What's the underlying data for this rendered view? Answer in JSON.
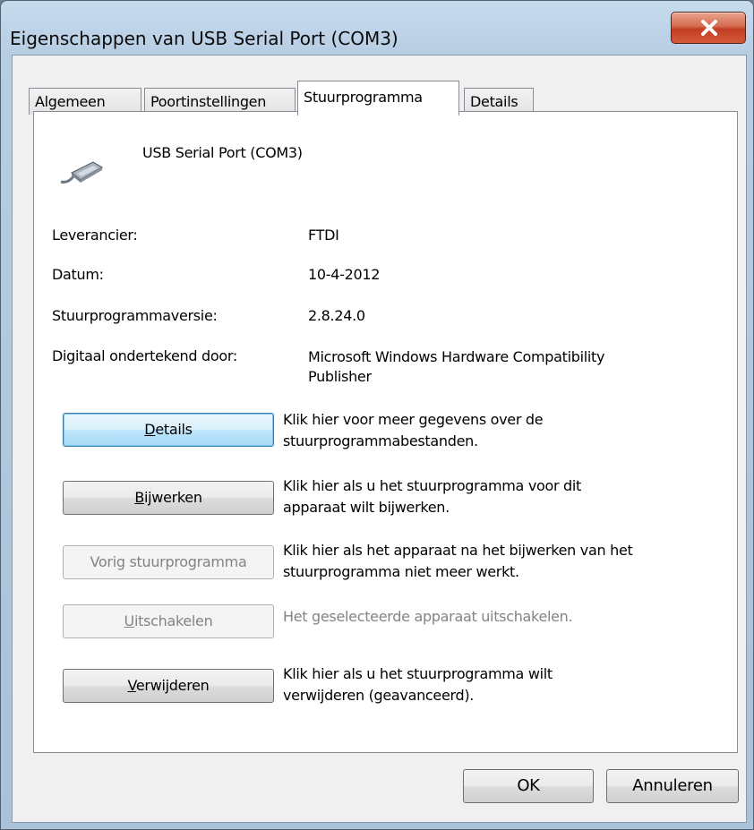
{
  "window": {
    "title": "Eigenschappen van USB Serial Port (COM3)",
    "close_glyph": "X"
  },
  "tabs": [
    {
      "label": "Algemeen"
    },
    {
      "label": "Poortinstellingen"
    },
    {
      "label": "Stuurprogramma",
      "active": true
    },
    {
      "label": "Details"
    }
  ],
  "device": {
    "name": "USB Serial Port (COM3)",
    "icon": "serial-cable-icon"
  },
  "info": {
    "provider_label": "Leverancier:",
    "provider_value": "FTDI",
    "date_label": "Datum:",
    "date_value": "10-4-2012",
    "version_label": "Stuurprogrammaversie:",
    "version_value": "2.8.24.0",
    "signer_label": "Digitaal ondertekend door:",
    "signer_value_line1": "Microsoft Windows Hardware Compatibility",
    "signer_value_line2": "Publisher"
  },
  "actions": {
    "details": {
      "label_pre": "",
      "label_key": "D",
      "label_post": "etails",
      "desc_line1": "Klik hier voor meer gegevens over de",
      "desc_line2": "stuurprogrammabestanden."
    },
    "update": {
      "label_pre": "",
      "label_key": "B",
      "label_post": "ijwerken",
      "desc_line1": "Klik hier als u het stuurprogramma voor dit",
      "desc_line2": "apparaat wilt bijwerken."
    },
    "rollback": {
      "label": "Vorig stuurprogramma",
      "desc_line1": "Klik hier als het apparaat na het bijwerken van het",
      "desc_line2": "stuurprogramma niet meer werkt."
    },
    "disable": {
      "label_pre": "",
      "label_key": "U",
      "label_post": "itschakelen",
      "desc_line1": "Het geselecteerde apparaat uitschakelen."
    },
    "uninstall": {
      "label_pre": "",
      "label_key": "V",
      "label_post": "erwijderen",
      "desc_line1": "Klik hier als u het stuurprogramma wilt",
      "desc_line2": "verwijderen (geavanceerd)."
    }
  },
  "footer": {
    "ok_label": "OK",
    "cancel_label": "Annuleren"
  }
}
